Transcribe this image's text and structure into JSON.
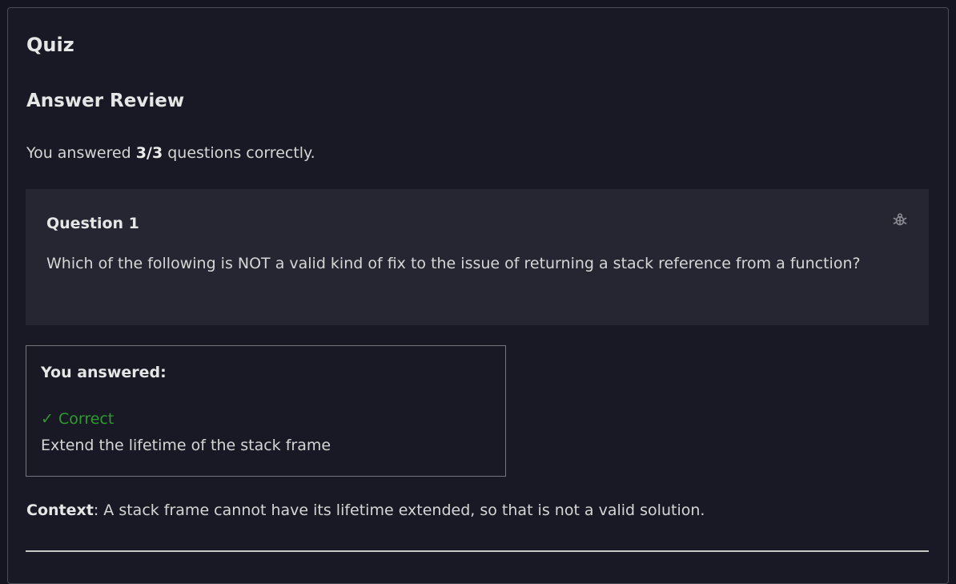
{
  "quiz": {
    "title": "Quiz",
    "review_heading": "Answer Review",
    "score": {
      "prefix": "You answered ",
      "value": "3/3",
      "suffix": " questions correctly."
    },
    "question": {
      "number_label": "Question 1",
      "text": "Which of the following is NOT a valid kind of fix to the issue of returning a stack reference from a function?",
      "report_icon": "bug-icon"
    },
    "answer": {
      "heading": "You answered:",
      "status": "✓ Correct",
      "text": "Extend the lifetime of the stack frame"
    },
    "context": {
      "label": "Context",
      "text": ": A stack frame cannot have its lifetime extended, so that is not a valid solution."
    }
  },
  "colors": {
    "background": "#181924",
    "card": "#252631",
    "correct": "#2f9a2f"
  }
}
